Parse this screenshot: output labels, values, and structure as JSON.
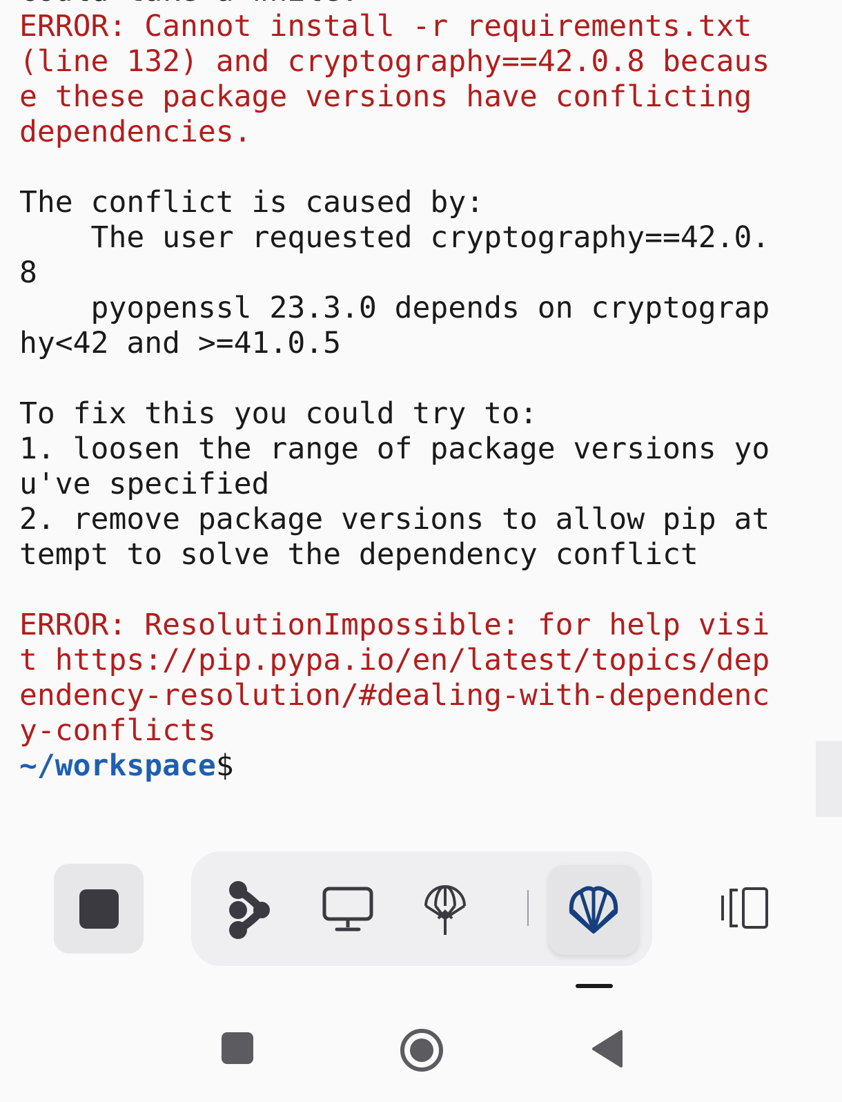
{
  "terminal": {
    "lines": [
      {
        "text": "could take a while.",
        "style": "normal"
      },
      {
        "text": "ERROR: Cannot install -r requirements.txt",
        "style": "error"
      },
      {
        "text": "(line 132) and cryptography==42.0.8 becaus",
        "style": "error"
      },
      {
        "text": "e these package versions have conflicting",
        "style": "error"
      },
      {
        "text": "dependencies.",
        "style": "error"
      },
      {
        "text": "",
        "style": "normal"
      },
      {
        "text": "The conflict is caused by:",
        "style": "normal"
      },
      {
        "text": "    The user requested cryptography==42.0.",
        "style": "normal"
      },
      {
        "text": "8",
        "style": "normal"
      },
      {
        "text": "    pyopenssl 23.3.0 depends on cryptograp",
        "style": "normal"
      },
      {
        "text": "hy<42 and >=41.0.5",
        "style": "normal"
      },
      {
        "text": "",
        "style": "normal"
      },
      {
        "text": "To fix this you could try to:",
        "style": "normal"
      },
      {
        "text": "1. loosen the range of package versions yo",
        "style": "normal"
      },
      {
        "text": "u've specified",
        "style": "normal"
      },
      {
        "text": "2. remove package versions to allow pip at",
        "style": "normal"
      },
      {
        "text": "tempt to solve the dependency conflict",
        "style": "normal"
      },
      {
        "text": "",
        "style": "normal"
      },
      {
        "text": "ERROR: ResolutionImpossible: for help visi",
        "style": "error"
      },
      {
        "text": "t https://pip.pypa.io/en/latest/topics/dep",
        "style": "error"
      },
      {
        "text": "endency-resolution/#dealing-with-dependenc",
        "style": "error"
      },
      {
        "text": "y-conflicts",
        "style": "error"
      }
    ],
    "prompt": {
      "path": "~/workspace",
      "symbol": "$"
    }
  },
  "toolbar": {
    "stop_icon": "stop-icon",
    "tools": [
      {
        "name": "git-branch",
        "icon": "branch-icon",
        "active": false
      },
      {
        "name": "desktop",
        "icon": "monitor-icon",
        "active": false
      },
      {
        "name": "deploy",
        "icon": "parachute-icon",
        "active": false
      },
      {
        "name": "shell",
        "icon": "shell-icon",
        "active": true
      }
    ],
    "layout_icon": "split-view-icon"
  },
  "system_nav": {
    "recents_icon": "recents-icon",
    "home_icon": "home-icon",
    "back_icon": "back-icon"
  },
  "colors": {
    "error": "#b31d1d",
    "prompt": "#1f5fb0",
    "text": "#1a1a1a",
    "active_icon": "#173f7d",
    "background": "#fafafa"
  }
}
